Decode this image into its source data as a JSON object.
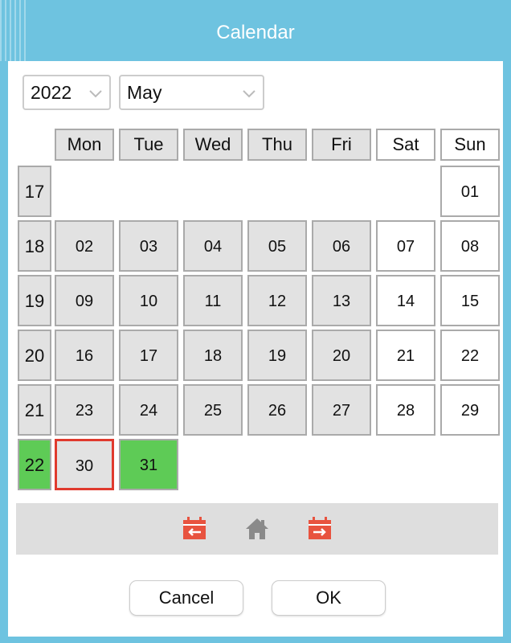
{
  "window": {
    "title": "Calendar"
  },
  "selectors": {
    "year": "2022",
    "month": "May"
  },
  "weekday_headers": [
    "Mon",
    "Tue",
    "Wed",
    "Thu",
    "Fri",
    "Sat",
    "Sun"
  ],
  "weeks": [
    {
      "week": "17",
      "days": [
        "",
        "",
        "",
        "",
        "",
        "",
        "01"
      ]
    },
    {
      "week": "18",
      "days": [
        "02",
        "03",
        "04",
        "05",
        "06",
        "07",
        "08"
      ]
    },
    {
      "week": "19",
      "days": [
        "09",
        "10",
        "11",
        "12",
        "13",
        "14",
        "15"
      ]
    },
    {
      "week": "20",
      "days": [
        "16",
        "17",
        "18",
        "19",
        "20",
        "21",
        "22"
      ]
    },
    {
      "week": "21",
      "days": [
        "23",
        "24",
        "25",
        "26",
        "27",
        "28",
        "29"
      ]
    },
    {
      "week": "22",
      "days": [
        "30",
        "31",
        "",
        "",
        "",
        "",
        ""
      ]
    }
  ],
  "today": "30",
  "selected_day": "31",
  "selected_week": "22",
  "colors": {
    "titlebar": "#6ec3e0",
    "selected": "#5ecb56",
    "today_border": "#e03a2e",
    "weekday_cell": "#e2e2e2",
    "nav_icon": "#e8533f",
    "home_icon": "#8a8a8a"
  },
  "nav": {
    "prev_icon": "calendar-prev-icon",
    "home_icon": "home-icon",
    "next_icon": "calendar-next-icon"
  },
  "buttons": {
    "cancel": "Cancel",
    "ok": "OK"
  }
}
